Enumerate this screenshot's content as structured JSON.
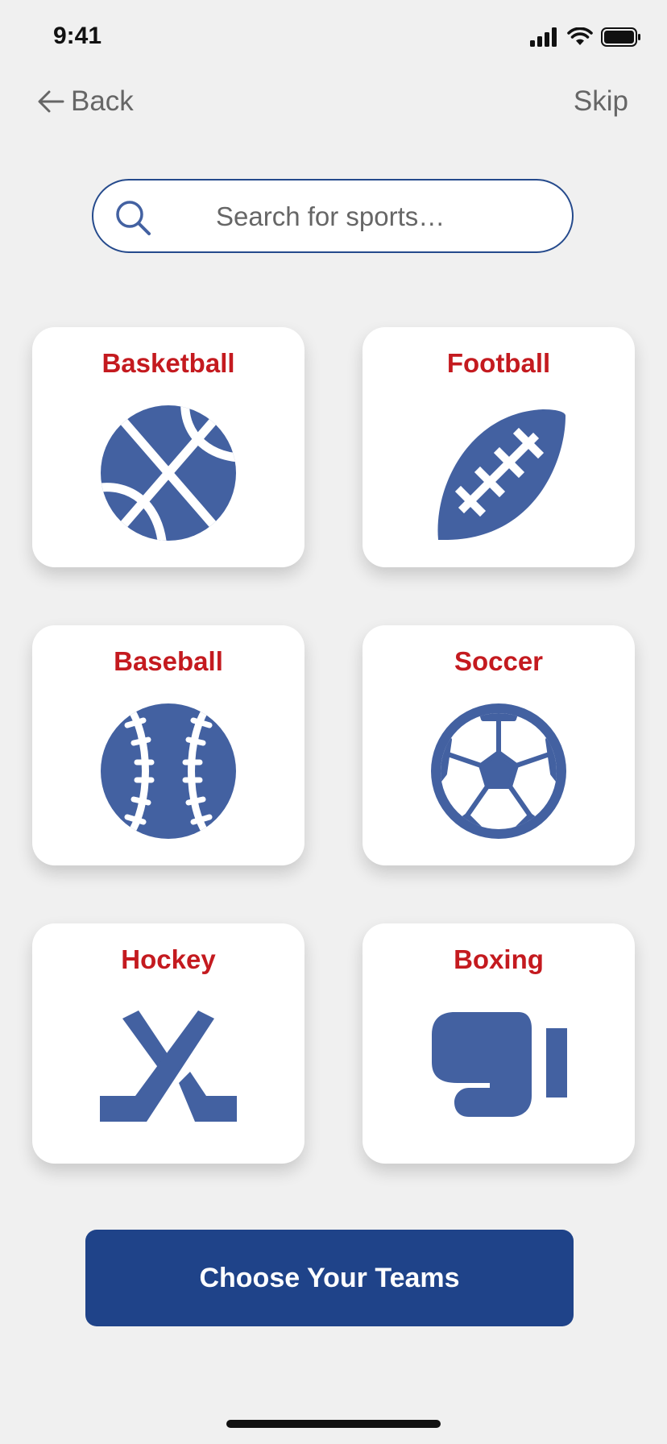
{
  "status_bar": {
    "time": "9:41"
  },
  "nav": {
    "back_label": "Back",
    "skip_label": "Skip"
  },
  "search": {
    "placeholder": "Search for sports…",
    "value": ""
  },
  "sports": [
    {
      "label": "Basketball",
      "icon": "basketball-icon"
    },
    {
      "label": "Football",
      "icon": "football-icon"
    },
    {
      "label": "Baseball",
      "icon": "baseball-icon"
    },
    {
      "label": "Soccer",
      "icon": "soccer-ball-icon"
    },
    {
      "label": "Hockey",
      "icon": "hockey-sticks-icon"
    },
    {
      "label": "Boxing",
      "icon": "boxing-glove-icon"
    }
  ],
  "cta": {
    "label": "Choose Your Teams"
  },
  "colors": {
    "background": "#f0f0f0",
    "accent_red": "#c41a1f",
    "icon_blue": "#4361a1",
    "button_blue": "#1f4389"
  }
}
